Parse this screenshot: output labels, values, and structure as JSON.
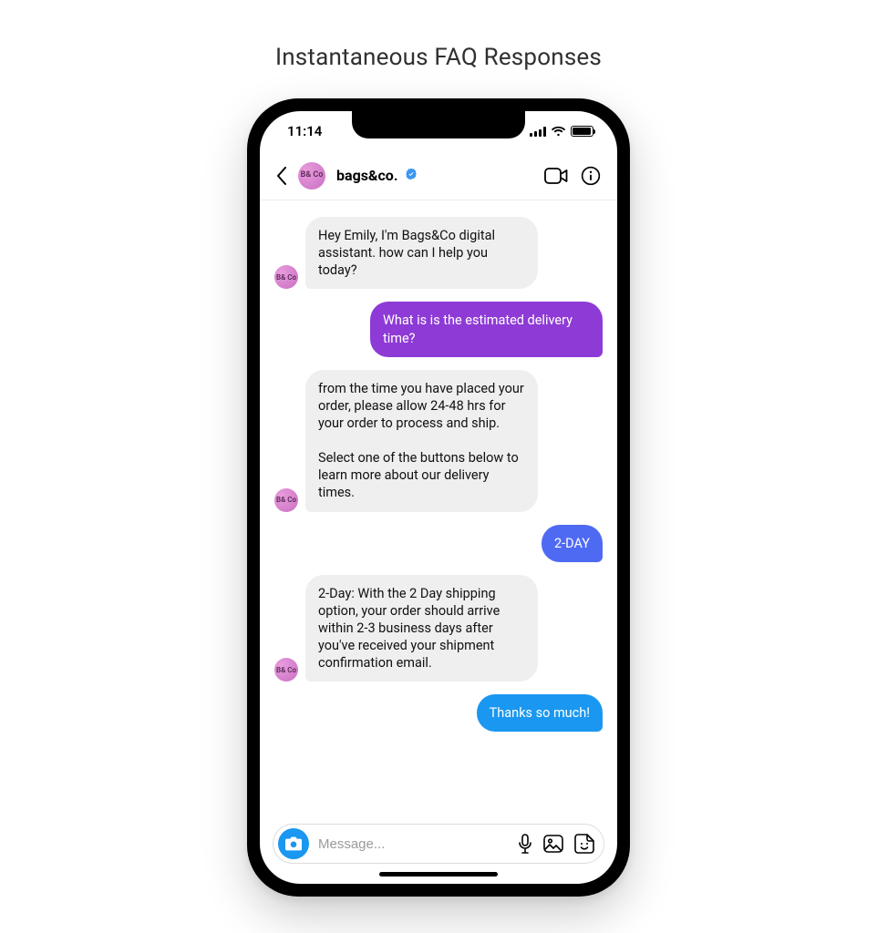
{
  "page": {
    "title": "Instantaneous FAQ Responses"
  },
  "status_bar": {
    "time": "11:14"
  },
  "header": {
    "avatar_text": "B&\nCo",
    "name": "bags&co."
  },
  "messages": [
    {
      "side": "in",
      "style": "in",
      "avatar": "B&\nCo",
      "text": "Hey Emily, I'm Bags&Co digital assistant. how can I help you today?"
    },
    {
      "side": "out",
      "style": "out-purple",
      "text": "What is is the estimated delivery time?"
    },
    {
      "side": "in",
      "style": "in",
      "avatar": "B&\nCo",
      "text": "from the time you have placed your order, please allow 24-48 hrs for your order to process and ship.\n\nSelect one of the buttons below to learn more about our delivery times."
    },
    {
      "side": "out",
      "style": "out-blue",
      "text": "2-DAY"
    },
    {
      "side": "in",
      "style": "in",
      "avatar": "B&\nCo",
      "text": "2-Day: With the 2 Day shipping option, your order should arrive within 2-3 business days after you've received your shipment confirmation email."
    },
    {
      "side": "out",
      "style": "out-blue2",
      "text": "Thanks so much!"
    }
  ],
  "composer": {
    "placeholder": "Message..."
  }
}
